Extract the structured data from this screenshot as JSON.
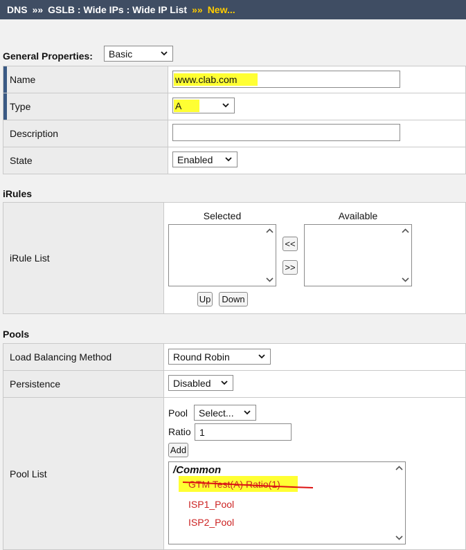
{
  "breadcrumb": {
    "items": [
      "DNS",
      "GSLB : Wide IPs : Wide IP List"
    ],
    "separator": "»»",
    "current": "New..."
  },
  "general": {
    "heading": "General Properties:",
    "mode": "Basic",
    "name_label": "Name",
    "name_value": "www.clab.com",
    "type_label": "Type",
    "type_value": "A",
    "description_label": "Description",
    "description_value": "",
    "state_label": "State",
    "state_value": "Enabled"
  },
  "irules": {
    "heading": "iRules",
    "row_label": "iRule List",
    "selected_label": "Selected",
    "available_label": "Available",
    "move_left": "<<",
    "move_right": ">>",
    "up_label": "Up",
    "down_label": "Down"
  },
  "pools": {
    "heading": "Pools",
    "lb_label": "Load Balancing Method",
    "lb_value": "Round Robin",
    "persistence_label": "Persistence",
    "persistence_value": "Disabled",
    "pool_list_label": "Pool List",
    "pool_label": "Pool",
    "pool_value": "Select...",
    "ratio_label": "Ratio",
    "ratio_value": "1",
    "add_label": "Add",
    "list_group": "/Common",
    "list_items": [
      "GTM Test(A) Ratio(1)",
      "ISP1_Pool",
      "ISP2_Pool"
    ]
  },
  "colors": {
    "header_bg": "#3f4d63",
    "current_crumb": "#ffcc00",
    "highlight": "#ffff33",
    "pool_item": "#cc2222",
    "required_bar": "#3b5a84"
  }
}
